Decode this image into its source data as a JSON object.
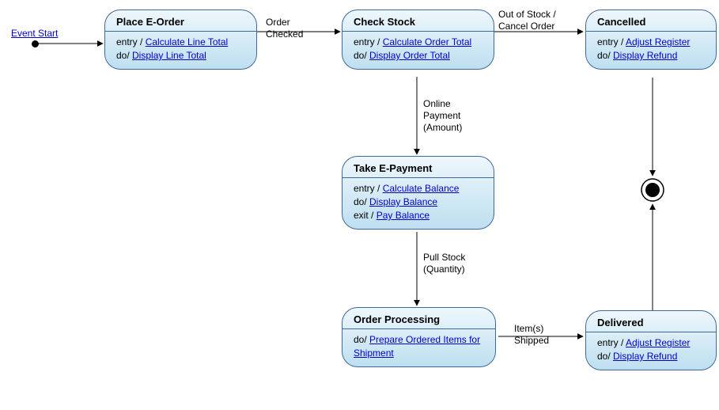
{
  "eventStart": "Event Start",
  "states": {
    "placeOrder": {
      "title": "Place E-Order",
      "entryPrefix": "entry / ",
      "entryLink": "Calculate Line Total",
      "doPrefix": "do/ ",
      "doLink": "Display Line Total"
    },
    "checkStock": {
      "title": "Check Stock",
      "entryPrefix": "entry / ",
      "entryLink": "Calculate Order Total",
      "doPrefix": "do/ ",
      "doLink": "Display Order Total"
    },
    "cancelled": {
      "title": "Cancelled",
      "entryPrefix": "entry / ",
      "entryLink": "Adjust Register",
      "doPrefix": "do/ ",
      "doLink": "Display Refund"
    },
    "takePayment": {
      "title": "Take E-Payment",
      "entryPrefix": "entry / ",
      "entryLink": "Calculate Balance",
      "doPrefix": "do/ ",
      "doLink": "Display Balance",
      "exitPrefix": "exit / ",
      "exitLink": "Pay Balance"
    },
    "orderProcessing": {
      "title": "Order Processing",
      "doPrefix": "do/ ",
      "doLink": "Prepare Ordered Items for Shipment"
    },
    "delivered": {
      "title": "Delivered",
      "entryPrefix": "entry / ",
      "entryLink": "Adjust Register",
      "doPrefix": "do/ ",
      "doLink": "Display Refund"
    }
  },
  "transitions": {
    "orderChecked": "Order\nChecked",
    "outOfStock": "Out of Stock /\nCancel Order",
    "onlinePayment": "Online\nPayment\n(Amount)",
    "pullStock": "Pull Stock\n(Quantity)",
    "itemsShipped": "Item(s)\nShipped"
  },
  "chart_data": {
    "type": "state_machine",
    "initial": "Event Start",
    "final": "Final",
    "states": [
      "Place E-Order",
      "Check Stock",
      "Cancelled",
      "Take E-Payment",
      "Order Processing",
      "Delivered"
    ],
    "transitions": [
      {
        "from": "Initial",
        "to": "Place E-Order",
        "label": "Event Start"
      },
      {
        "from": "Place E-Order",
        "to": "Check Stock",
        "label": "Order Checked"
      },
      {
        "from": "Check Stock",
        "to": "Cancelled",
        "label": "Out of Stock / Cancel Order"
      },
      {
        "from": "Check Stock",
        "to": "Take E-Payment",
        "label": "Online Payment (Amount)"
      },
      {
        "from": "Take E-Payment",
        "to": "Order Processing",
        "label": "Pull Stock (Quantity)"
      },
      {
        "from": "Order Processing",
        "to": "Delivered",
        "label": "Item(s) Shipped"
      },
      {
        "from": "Delivered",
        "to": "Final",
        "label": ""
      },
      {
        "from": "Cancelled",
        "to": "Final",
        "label": ""
      }
    ],
    "state_actions": {
      "Place E-Order": {
        "entry": "Calculate Line Total",
        "do": "Display Line Total"
      },
      "Check Stock": {
        "entry": "Calculate Order Total",
        "do": "Display Order Total"
      },
      "Cancelled": {
        "entry": "Adjust Register",
        "do": "Display Refund"
      },
      "Take E-Payment": {
        "entry": "Calculate Balance",
        "do": "Display Balance",
        "exit": "Pay Balance"
      },
      "Order Processing": {
        "do": "Prepare Ordered Items for Shipment"
      },
      "Delivered": {
        "entry": "Adjust Register",
        "do": "Display Refund"
      }
    }
  }
}
